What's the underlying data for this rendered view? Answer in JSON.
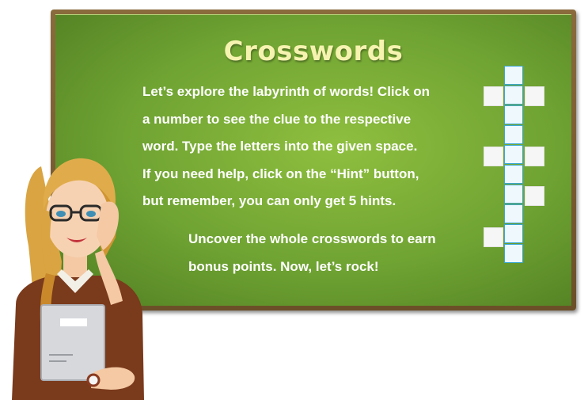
{
  "title": "Crosswords",
  "intro_lines": [
    "Let’s explore the labyrinth of words! Click on",
    "a number to see the clue to the respective",
    "word. Type the letters into the given space.",
    "If you need help, click on the “Hint” button,",
    "but remember, you can only get 5 hints."
  ],
  "outro_lines": [
    "Uncover the whole crosswords to earn",
    "bonus points. Now, let’s rock!"
  ],
  "colors": {
    "board_green": "#6ea232",
    "frame_brown": "#7a5b30",
    "title_yellow": "#f6f3b0",
    "cell_border": "#3aa7d2"
  },
  "icons": [
    "teacher-illustration",
    "crossword-grid-icon"
  ]
}
